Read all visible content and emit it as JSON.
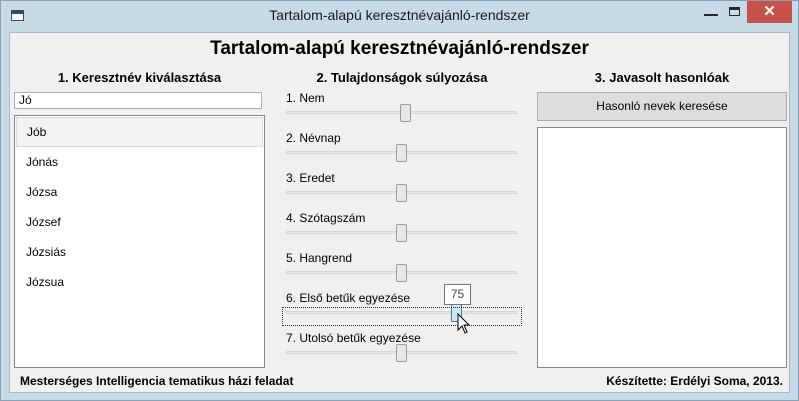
{
  "window": {
    "title": "Tartalom-alapú keresztnévajánló-rendszer"
  },
  "main_title": "Tartalom-alapú keresztnévajánló-rendszer",
  "columns": {
    "col1": "1. Keresztnév kiválasztása",
    "col2": "2. Tulajdonságok súlyozása",
    "col3": "3. Javasolt hasonlóak"
  },
  "search": {
    "value": "Jó"
  },
  "names": [
    "Jób",
    "Jónás",
    "Józsa",
    "József",
    "Józsiás",
    "Józsua"
  ],
  "selected_index": 0,
  "sliders": [
    {
      "label": "1. Nem",
      "value": 0.52
    },
    {
      "label": "2. Névnap",
      "value": 0.5
    },
    {
      "label": "3. Eredet",
      "value": 0.5
    },
    {
      "label": "4. Szótagszám",
      "value": 0.5
    },
    {
      "label": "5. Hangrend",
      "value": 0.5
    },
    {
      "label": "6. Első betűk egyezése",
      "value": 0.75
    },
    {
      "label": "7. Utolsó betűk egyezése",
      "value": 0.5
    }
  ],
  "active_slider_index": 5,
  "tooltip_value": "75",
  "find_button": "Hasonló nevek keresése",
  "footer": {
    "left": "Mesterséges Intelligencia tematikus házi feladat",
    "right": "Készítette: Erdélyi Soma, 2013."
  },
  "colors": {
    "close_button": "#c7504b",
    "frame": "#c6dbe8",
    "active_thumb": "#cfe6f7"
  },
  "icons": {
    "app": "window-icon",
    "minimize": "minimize-icon",
    "maximize": "maximize-icon",
    "close": "close-icon",
    "cursor": "mouse-cursor-icon"
  }
}
